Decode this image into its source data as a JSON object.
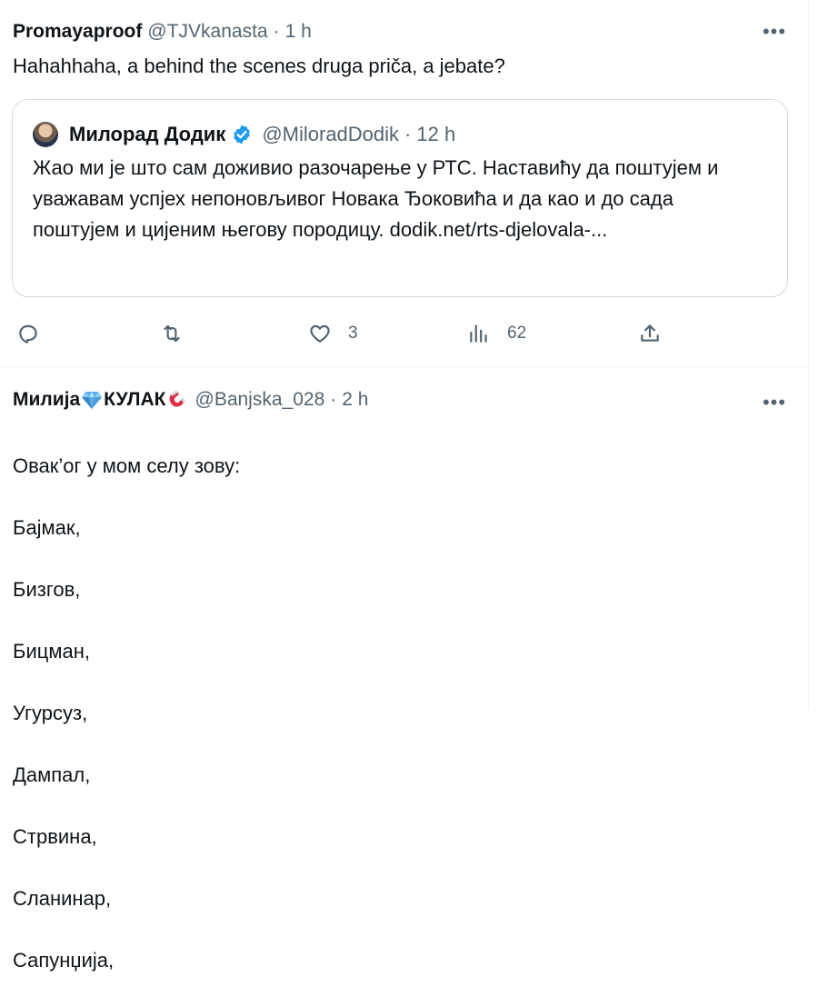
{
  "tweet1": {
    "name": "Promayaproof",
    "handle": "@TJVkanasta",
    "separator": "·",
    "time": "1 h",
    "more_label": "•••",
    "text": "Hahahhaha, a behind the scenes druga priča, a jebate?",
    "quote": {
      "name": "Милорад Додик",
      "verified": true,
      "handle": "@MiloradDodik",
      "separator": "·",
      "time": "12 h",
      "text": "Жао ми је што сам доживио разочарење у РТС. Наставићу да поштујем и уважавам успјех непоновљивог Новака Ђоковића и да као и до сада поштујем и цијеним његову породицу.",
      "link": "dodik.net/rts-djelovala-..."
    },
    "actions": {
      "reply_icon": "reply-icon",
      "retweet_icon": "retweet-icon",
      "like_icon": "heart-icon",
      "like_count": "3",
      "views_icon": "views-icon",
      "views_count": "62",
      "share_icon": "share-icon"
    }
  },
  "tweet2": {
    "name_part1": "Милија",
    "name_emoji1": "gem-emoji",
    "name_part2": "КУЛАК",
    "name_emoji2": "magnet-emoji",
    "handle": "@Banjska_028",
    "separator": "·",
    "time": "2 h",
    "more_label": "•••",
    "lines": [
      "Овак’ог у мом селу зову:",
      "Бајмак,",
      "Бизгов,",
      "Бицман,",
      "Угурсуз,",
      "Дампал,",
      "Стрвина,",
      "Сланинар,",
      "Сапунџија,"
    ]
  },
  "colors": {
    "text": "#0f1419",
    "secondary": "#536471",
    "border": "#cfd9de",
    "verified_blue": "#1d9bf0"
  }
}
